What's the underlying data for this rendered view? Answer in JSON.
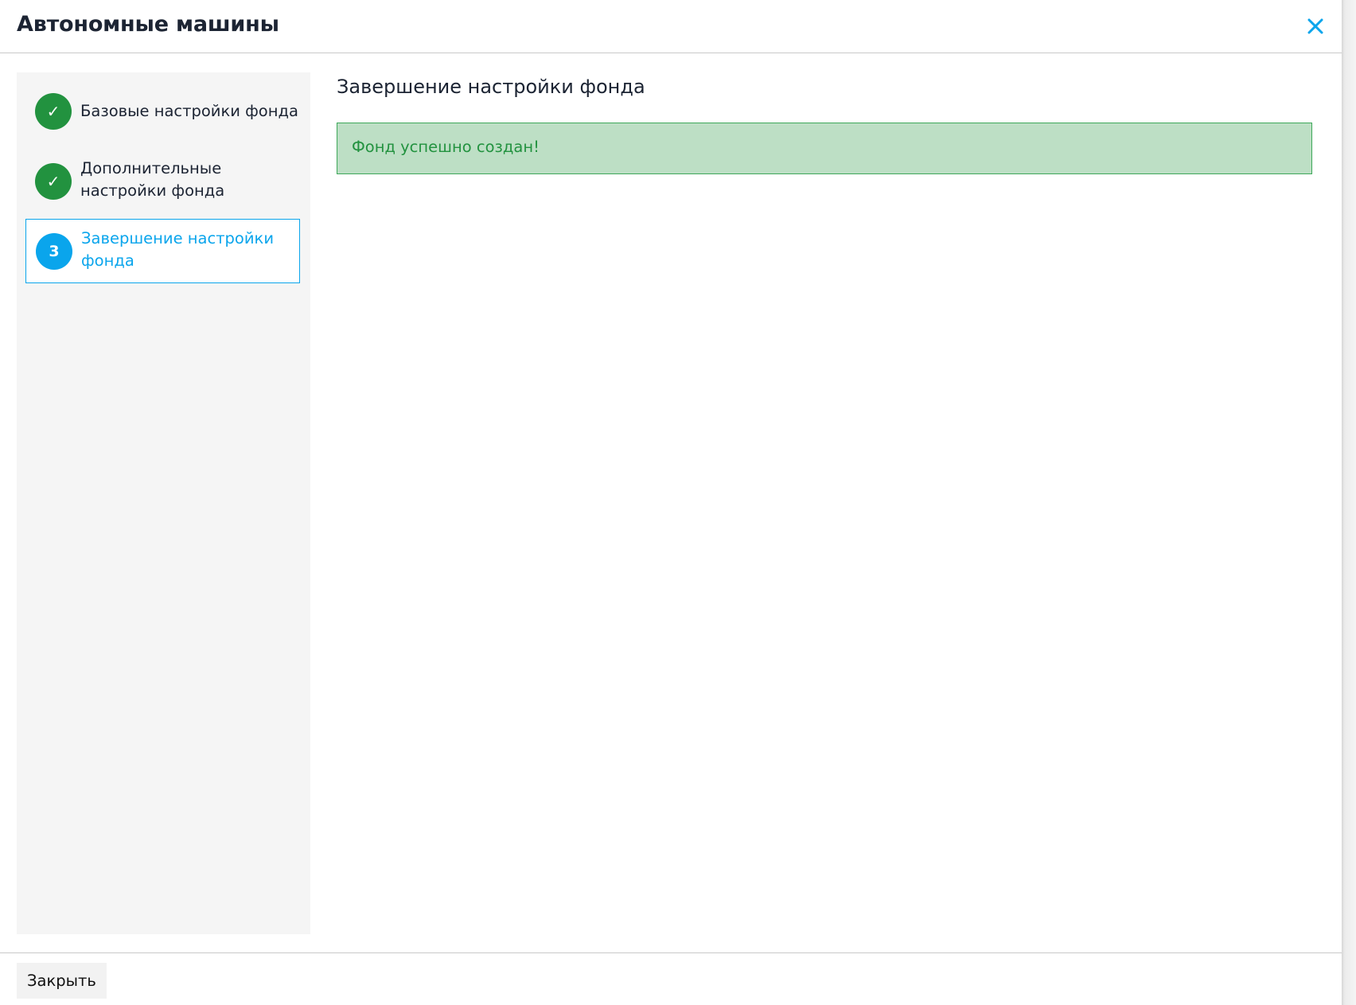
{
  "header": {
    "title": "Автономные машины",
    "close_icon": "close-icon"
  },
  "colors": {
    "accent": "#0aa5ec",
    "success": "#22923f",
    "alert_bg": "#bddfc5",
    "text": "#1c2433"
  },
  "steps": [
    {
      "label": "Базовые настройки фонда",
      "marker": "✓",
      "state": "completed"
    },
    {
      "label": "Дополнительные настройки фонда",
      "marker": "✓",
      "state": "completed"
    },
    {
      "label": "Завершение настройки фонда",
      "marker": "3",
      "state": "active"
    }
  ],
  "main": {
    "title": "Завершение настройки фонда",
    "alert_text": "Фонд успешно создан!"
  },
  "footer": {
    "close_label": "Закрыть"
  }
}
